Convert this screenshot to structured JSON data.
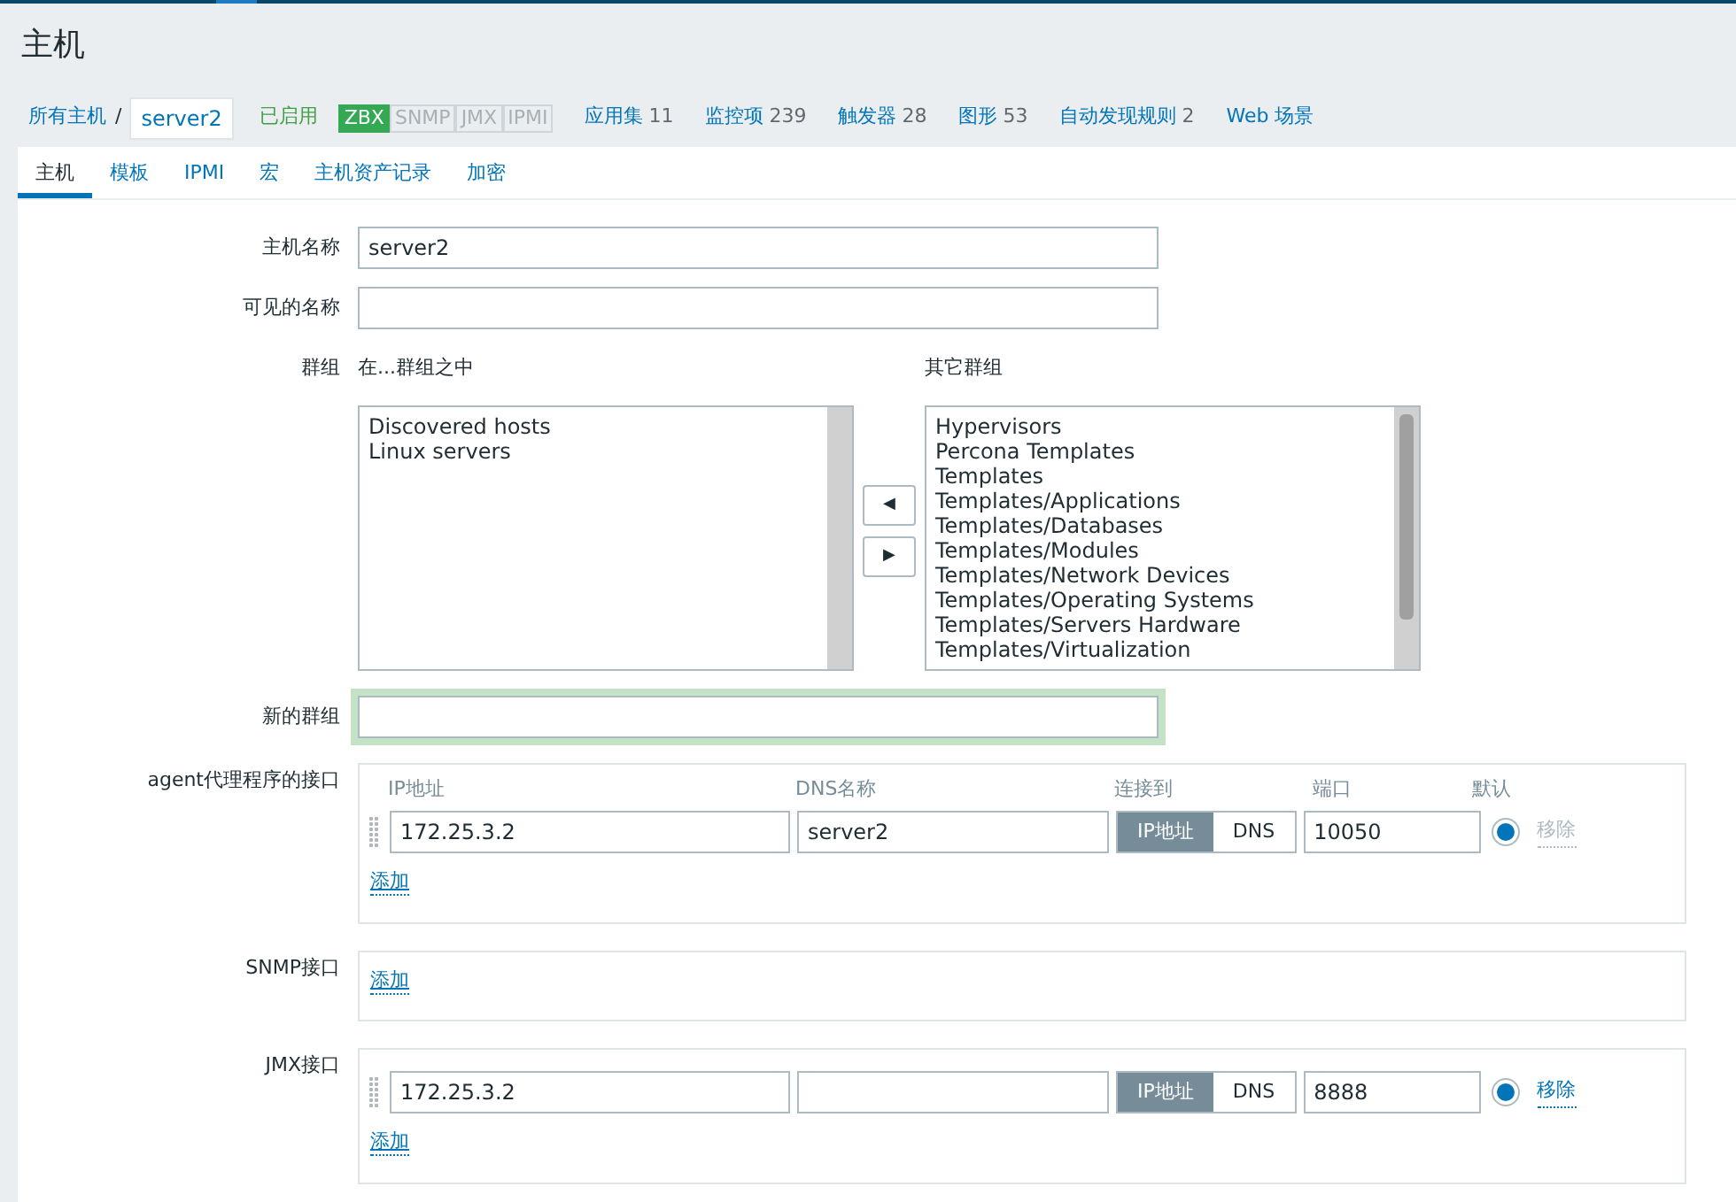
{
  "page_title": "主机",
  "breadcrumb": {
    "all_hosts": "所有主机",
    "separator": "/",
    "current": "server2",
    "status": "已启用",
    "availability": [
      {
        "label": "ZBX",
        "active": true
      },
      {
        "label": "SNMP",
        "active": false
      },
      {
        "label": "JMX",
        "active": false
      },
      {
        "label": "IPMI",
        "active": false
      }
    ],
    "links": [
      {
        "label": "应用集",
        "count": "11"
      },
      {
        "label": "监控项",
        "count": "239"
      },
      {
        "label": "触发器",
        "count": "28"
      },
      {
        "label": "图形",
        "count": "53"
      },
      {
        "label": "自动发现规则",
        "count": "2"
      },
      {
        "label": "Web 场景"
      }
    ]
  },
  "tabs": [
    {
      "label": "主机",
      "selected": true
    },
    {
      "label": "模板",
      "selected": false
    },
    {
      "label": "IPMI",
      "selected": false
    },
    {
      "label": "宏",
      "selected": false
    },
    {
      "label": "主机资产记录",
      "selected": false
    },
    {
      "label": "加密",
      "selected": false
    }
  ],
  "form": {
    "host_name": {
      "label": "主机名称",
      "value": "server2"
    },
    "visible_name": {
      "label": "可见的名称"
    },
    "groups": {
      "label": "群组",
      "in_groups_label": "在...群组之中",
      "other_groups_label": "其它群组",
      "in_groups": [
        "Discovered hosts",
        "Linux servers"
      ],
      "other_groups": [
        "Hypervisors",
        "Percona Templates",
        "Templates",
        "Templates/Applications",
        "Templates/Databases",
        "Templates/Modules",
        "Templates/Network Devices",
        "Templates/Operating Systems",
        "Templates/Servers Hardware",
        "Templates/Virtualization"
      ],
      "move_left": "◀",
      "move_right": "▶"
    },
    "new_group": {
      "label": "新的群组",
      "focused": true
    },
    "interfaces": [
      {
        "label": "agent代理程序的接口",
        "headers": [
          "IP地址",
          "DNS名称",
          "连接到",
          "端口",
          "默认"
        ],
        "add": "添加",
        "rows": [
          {
            "ip": "172.25.3.2",
            "dns": "server2",
            "connect": [
              {
                "label": "IP地址",
                "selected": true
              },
              {
                "label": "DNS",
                "selected": false
              }
            ],
            "port": "10050",
            "default": true,
            "remove": {
              "label": "移除",
              "disabled": true
            }
          }
        ]
      },
      {
        "label": "SNMP接口",
        "add": "添加"
      },
      {
        "label": "JMX接口",
        "add": "添加",
        "rows": [
          {
            "ip": "172.25.3.2",
            "dns": "",
            "connect": [
              {
                "label": "IP地址",
                "selected": true
              },
              {
                "label": "DNS",
                "selected": false
              }
            ],
            "port": "8888",
            "default": true,
            "remove": {
              "label": "移除",
              "disabled": false
            }
          }
        ]
      }
    ]
  }
}
